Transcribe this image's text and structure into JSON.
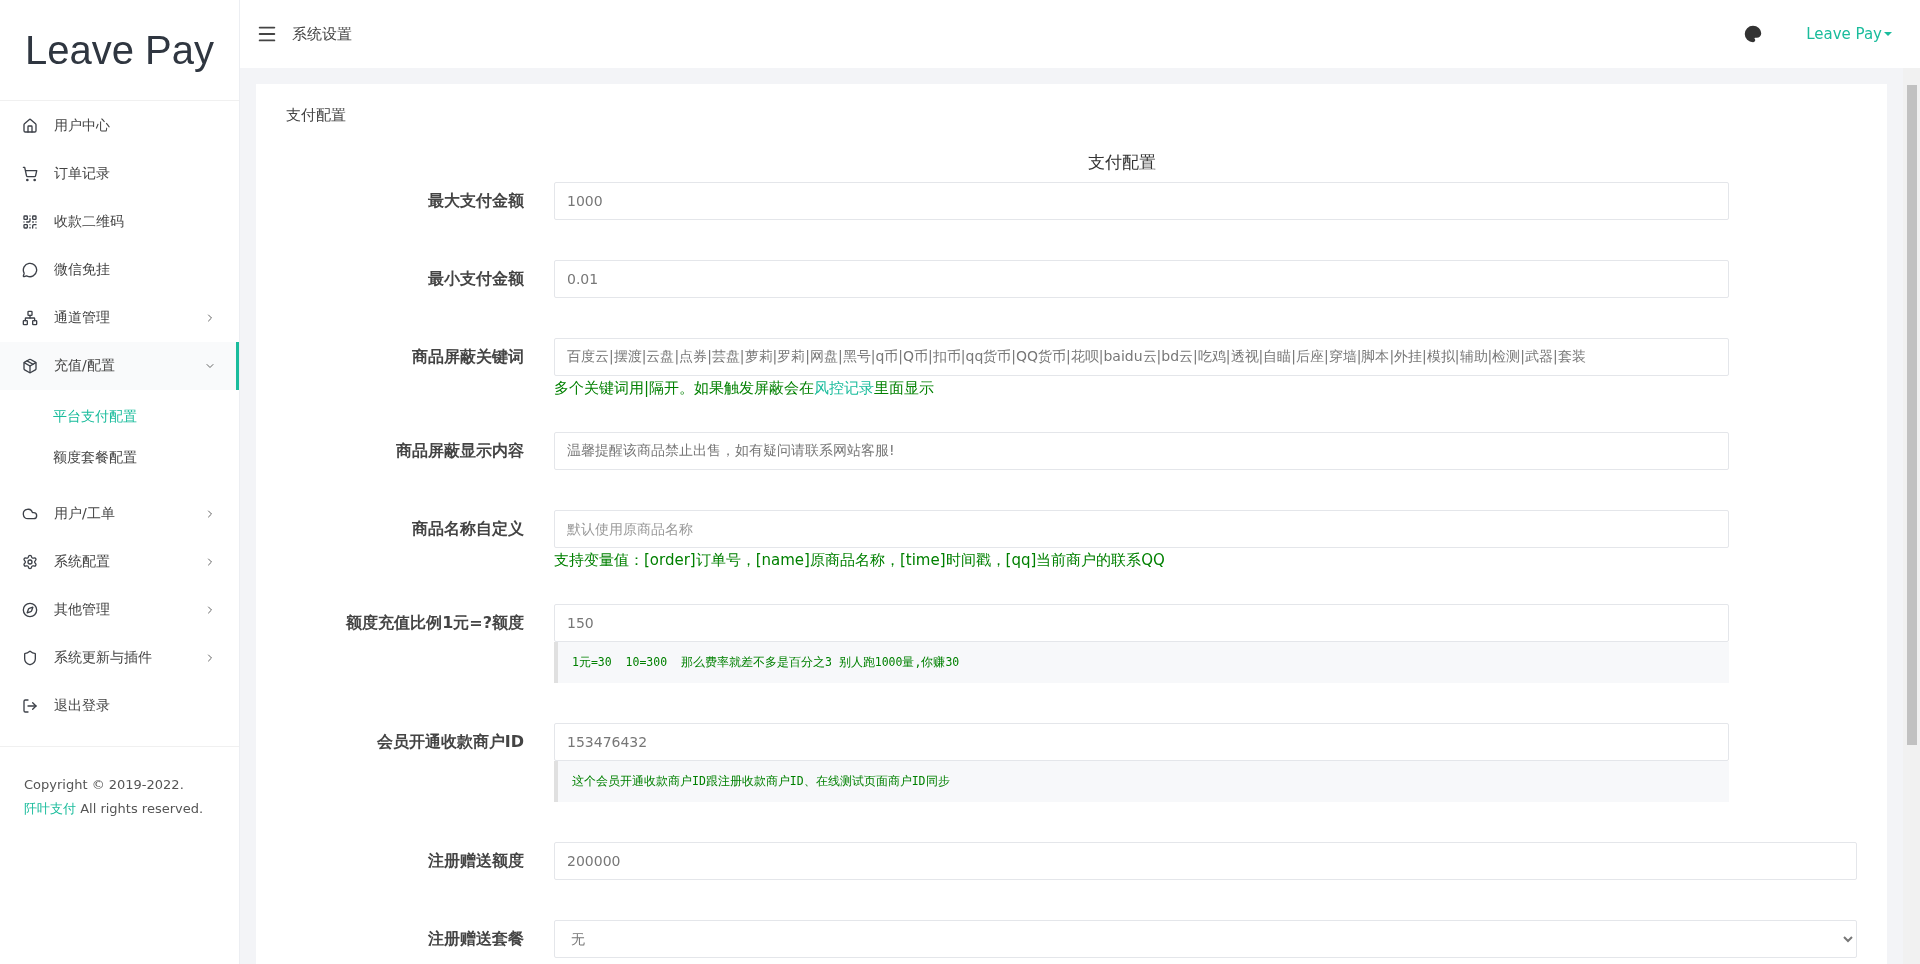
{
  "sidebar": {
    "logo": "Leave Pay",
    "items": [
      {
        "label": "用户中心",
        "selected": false
      },
      {
        "label": "订单记录",
        "selected": false
      },
      {
        "label": "收款二维码",
        "selected": false
      },
      {
        "label": "微信免挂",
        "selected": false
      },
      {
        "label": "通道管理",
        "selected": false,
        "expanded": false
      },
      {
        "label": "充值/配置",
        "selected": true,
        "expanded": true,
        "children": [
          {
            "label": "平台支付配置",
            "selected": true
          },
          {
            "label": "额度套餐配置",
            "selected": false
          }
        ]
      },
      {
        "label": "用户/工单",
        "selected": false,
        "expanded": false
      },
      {
        "label": "系统配置",
        "selected": false,
        "expanded": false
      },
      {
        "label": "其他管理",
        "selected": false,
        "expanded": false
      },
      {
        "label": "系统更新与插件",
        "selected": false,
        "expanded": false
      },
      {
        "label": "退出登录",
        "selected": false
      }
    ],
    "footer": {
      "text_before": "Copyright © 2019-2022. ",
      "link": "阡叶支付",
      "text_after": " All rights reserved."
    }
  },
  "header": {
    "title": "系统设置",
    "user": "Leave Pay"
  },
  "card": {
    "title": "支付配置",
    "form_title": "支付配置",
    "fields": [
      {
        "label": "最大支付金额",
        "kind": "input",
        "value": "1000"
      },
      {
        "label": "最小支付金额",
        "kind": "input",
        "value": "0.01"
      },
      {
        "label": "商品屏蔽关键词",
        "kind": "input",
        "value": "百度云|摆渡|云盘|点券|芸盘|萝莉|罗莉|网盘|黑号|q币|Q币|扣币|qq货币|QQ货币|花呗|baidu云|bd云|吃鸡|透视|自瞄|后座|穿墙|脚本|外挂|模拟|辅助|检测|武器|套装",
        "help": {
          "kind": "text",
          "parts": [
            {
              "kind": "text",
              "text": "多个关键词用|隔开。如果触发屏蔽会在"
            },
            {
              "kind": "link",
              "text": "风控记录"
            },
            {
              "kind": "text",
              "text": "里面显示"
            }
          ]
        }
      },
      {
        "label": "商品屏蔽显示内容",
        "kind": "input",
        "value": "温馨提醒该商品禁止出售，如有疑问请联系网站客服!"
      },
      {
        "label": "商品名称自定义",
        "kind": "input",
        "placeholder": "默认使用原商品名称",
        "help": {
          "kind": "text",
          "parts": [
            {
              "kind": "text",
              "text": "支持变量值：[order]订单号，[name]原商品名称，[time]时间戳，[qq]当前商户的联系QQ"
            }
          ]
        }
      },
      {
        "label": "额度充值比例1元=?额度",
        "kind": "input",
        "value": "150",
        "help": {
          "kind": "code",
          "parts": [
            {
              "kind": "text",
              "text": "1元=30  10=300  那么费率就差不多是百分之3 别人跑1000量,你赚30"
            }
          ]
        }
      },
      {
        "label": "会员开通收款商户ID",
        "kind": "input",
        "value": "153476432",
        "help": {
          "kind": "code",
          "parts": [
            {
              "kind": "text",
              "text": "这个会员开通收款商户ID跟注册收款商户ID、在线测试页面商户ID同步"
            }
          ]
        }
      },
      {
        "label": "注册赠送额度",
        "kind": "input",
        "value": "200000"
      },
      {
        "label": "注册赠送套餐",
        "kind": "select",
        "value": "无"
      }
    ]
  }
}
